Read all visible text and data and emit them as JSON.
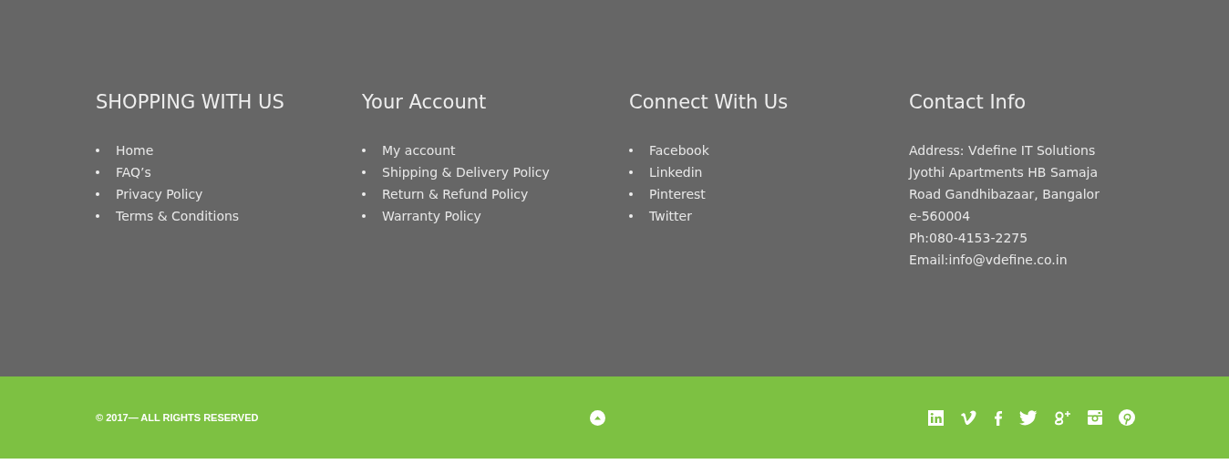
{
  "columns": [
    {
      "kind": "list",
      "heading": "SHOPPING WITH US",
      "items": [
        "Home",
        "FAQ’s",
        "Privacy Policy",
        "Terms & Conditions"
      ]
    },
    {
      "kind": "list",
      "heading": "Your Account",
      "items": [
        "My account",
        "Shipping & Delivery Policy",
        "Return & Refund Policy",
        "Warranty Policy"
      ]
    },
    {
      "kind": "list",
      "heading": "Connect With Us",
      "items": [
        "Facebook",
        "Linkedin",
        "Pinterest",
        "Twitter"
      ]
    },
    {
      "kind": "text",
      "heading": "Contact Info",
      "lines": [
        "Address: Vdefine IT Solutions",
        "Jyothi Apartments HB Samaja",
        "Road Gandhibazaar, Bangalor",
        "e-560004",
        "Ph:080-4153-2275",
        "Email:info@vdefine.co.in"
      ]
    }
  ],
  "bottom_bar": {
    "copyright": "© 2017— ALL RIGHTS RESERVED",
    "social": [
      {
        "kind": "linkedin"
      },
      {
        "kind": "vimeo"
      },
      {
        "kind": "facebook"
      },
      {
        "kind": "twitter"
      },
      {
        "kind": "google-plus"
      },
      {
        "kind": "instagram"
      },
      {
        "kind": "pinterest"
      }
    ]
  }
}
